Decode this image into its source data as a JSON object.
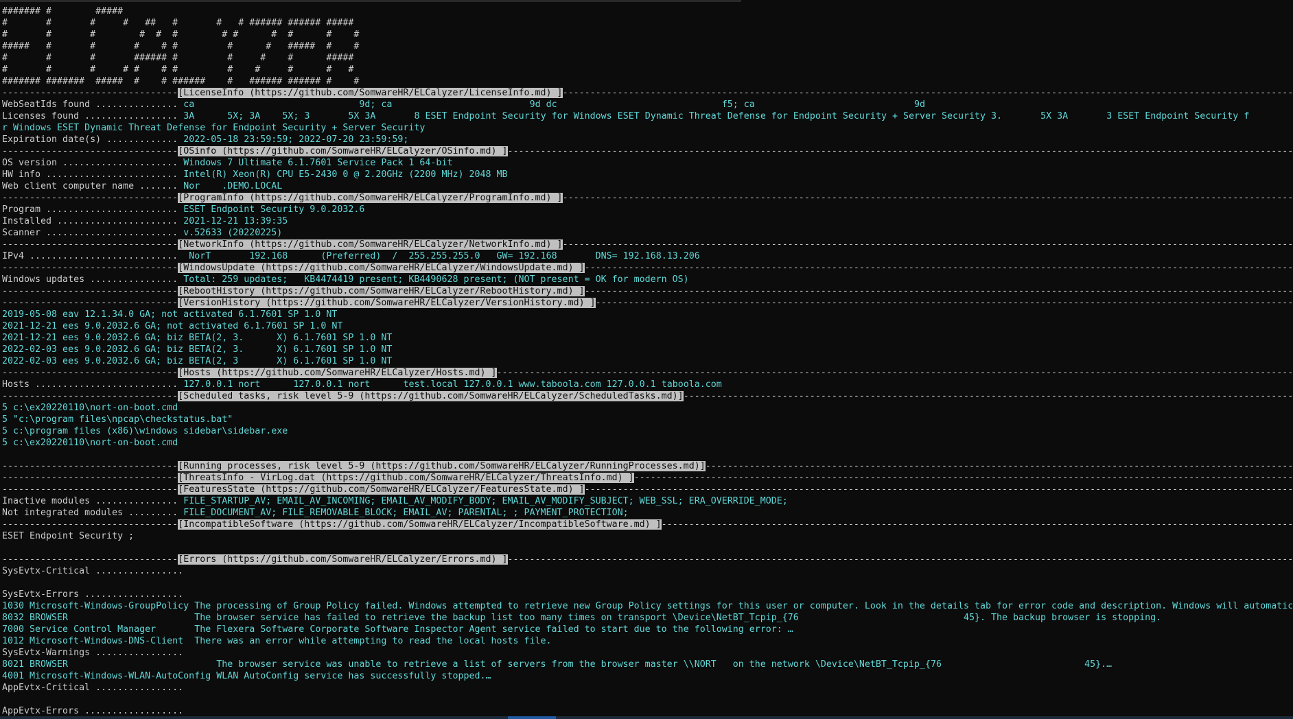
{
  "banner": [
    "####### #        #####",
    "#       #       #     #   ##   #       #   # ###### ###### #####",
    "#       #       #        #  #  #        # #      #  #      #    #",
    "#####   #       #       #    # #         #      #   #####  #    #",
    "#       #       #       ###### #         #     #    #      #####",
    "#       #       #     # #    # #         #    #     #      #   #",
    "####### #######  #####  #    # ######    #   ###### ###### #    #"
  ],
  "separator": "--------------------------------------------------------------------------------------------------------------------------------------------------------------------------------------------------------------------------------------------------------------------------------------------------------------",
  "sections": {
    "license": "[LicenseInfo (https://github.com/SomwareHR/ELCalyzer/LicenseInfo.md) ]",
    "os": "[OSinfo (https://github.com/SomwareHR/ELCalyzer/OSinfo.md) ]",
    "program": "[ProgramInfo (https://github.com/SomwareHR/ELCalyzer/ProgramInfo.md) ]",
    "network": "[NetworkInfo (https://github.com/SomwareHR/ELCalyzer/NetworkInfo.md) ]",
    "windows_update": "[WindowsUpdate (https://github.com/SomwareHR/ELCalyzer/WindowsUpdate.md) ]",
    "reboot": "[RebootHistory (https://github.com/SomwareHR/ELCalyzer/RebootHistory.md) ]",
    "version": "[VersionHistory (https://github.com/SomwareHR/ELCalyzer/VersionHistory.md) ]",
    "hosts": "[Hosts (https://github.com/SomwareHR/ELCalyzer/Hosts.md) ]",
    "scheduled": "[Scheduled tasks, risk level 5-9 (https://github.com/SomwareHR/ELCalyzer/ScheduledTasks.md)]",
    "running": "[Running processes, risk level 5-9 (https://github.com/SomwareHR/ELCalyzer/RunningProcesses.md)]",
    "threats": "[ThreatsInfo - VirLog.dat (https://github.com/SomwareHR/ELCalyzer/ThreatsInfo.md) ]",
    "features": "[FeaturesState (https://github.com/SomwareHR/ELCalyzer/FeaturesState.md) ]",
    "incompatible": "[IncompatibleSoftware (https://github.com/SomwareHR/ELCalyzer/IncompatibleSoftware.md) ]",
    "errors": "[Errors (https://github.com/SomwareHR/ELCalyzer/Errors.md) ]"
  },
  "license": {
    "seat_label": "WebSeatIds found ............... ",
    "seat_a": "ca",
    "seat_b": "9d; ca",
    "seat_c": "9d dc",
    "seat_d": "f5; ca",
    "seat_e": "9d",
    "lic_label": "Licenses found ................. ",
    "lic_a": "3A",
    "lic_b": "5X; 3A",
    "lic_c": "5X; 3",
    "lic_d": "5X 3A",
    "lic_e": "8 ESET Endpoint Security for Windows ESET Dynamic Threat Defense for Endpoint Security + Server Security 3.",
    "lic_f": "5X 3A",
    "lic_g": "3 ESET Endpoint Security f",
    "lic_cont": "r Windows ESET Dynamic Threat Defense for Endpoint Security + Server Security",
    "exp_label": "Expiration date(s) ............. ",
    "exp_value": "2022-05-18 23:59:59; 2022-07-20 23:59:59;"
  },
  "os": {
    "ver_label": "OS version ..................... ",
    "ver_value": "Windows 7 Ultimate 6.1.7601 Service Pack 1 64-bit",
    "hw_label": "HW info ........................ ",
    "hw_value": "Intel(R) Xeon(R) CPU E5-2430 0 @ 2.20GHz (2200 MHz) 2048 MB",
    "client_label": "Web client computer name ....... ",
    "client_a": "Nor",
    "client_b": ".DEMO.LOCAL"
  },
  "program": {
    "prog_label": "Program ........................ ",
    "prog_value": "ESET Endpoint Security 9.0.2032.6",
    "inst_label": "Installed ...................... ",
    "inst_value": "2021-12-21 13:39:35",
    "scan_label": "Scanner ........................ ",
    "scan_value": "v.52633 (20220225)"
  },
  "network": {
    "ipv4_label": "IPv4 ........................... ",
    "ipv4_a": " NorT",
    "ipv4_b": " 192.168",
    "ipv4_c": "(Preferred)  /  255.255.255.0   GW= 192.168",
    "ipv4_d": "DNS= 192.168.13.206"
  },
  "windows_update": {
    "label": "Windows updates ................ ",
    "value": "Total: 259 updates;   KB4474419 present; KB4490628 present; (NOT present = OK for modern OS)"
  },
  "versions": [
    {
      "a": "2019-05-08 eav 12.1.34.0 GA; not activated 6.1.7601 SP 1.0 NT",
      "b": "",
      "c": ""
    },
    {
      "a": "2021-12-21 ees 9.0.2032.6 GA; not activated 6.1.7601 SP 1.0 NT",
      "b": "",
      "c": ""
    },
    {
      "a": "2021-12-21 ees 9.0.2032.6 GA; biz BETA(2, 3.",
      "b": "",
      "c": "X) 6.1.7601 SP 1.0 NT"
    },
    {
      "a": "2022-02-03 ees 9.0.2032.6 GA; biz BETA(2, 3.",
      "b": "",
      "c": "X) 6.1.7601 SP 1.0 NT"
    },
    {
      "a": "2022-02-03 ees 9.0.2032.6 GA; biz BETA(2, 3",
      "b": "",
      "c": "X) 6.1.7601 SP 1.0 NT"
    }
  ],
  "hosts": {
    "label": "Hosts .......................... ",
    "a": "127.0.0.1 nort",
    "b": "127.0.0.1 nort",
    "c": "test.local 127.0.0.1 www.taboola.com 127.0.0.1 taboola.com"
  },
  "scheduled_tasks": [
    "5 c:\\ex20220110\\nort-on-boot.cmd",
    "5 \"c:\\program files\\npcap\\checkstatus.bat\"",
    "5 c:\\program files (x86)\\windows sidebar\\sidebar.exe",
    "5 c:\\ex20220110\\nort-on-boot.cmd"
  ],
  "features": {
    "inactive_label": "Inactive modules ............... ",
    "inactive_value": "FILE_STARTUP_AV; EMAIL_AV_INCOMING; EMAIL_AV_MODIFY_BODY; EMAIL_AV_MODIFY_SUBJECT; WEB_SSL; ERA_OVERRIDE_MODE;",
    "notint_label": "Not integrated modules ......... ",
    "notint_value": "FILE_DOCUMENT_AV; FILE_REMOVABLE_BLOCK; EMAIL_AV; PARENTAL; ; PAYMENT_PROTECTION;"
  },
  "incompatible_value": "ESET Endpoint Security ;",
  "errors": {
    "sys_critical": "SysEvtx-Critical ................",
    "sys_errors": "SysEvtx-Errors ..................",
    "e1_src": "1030 Microsoft-Windows-GroupPolicy ",
    "e1_msg": "The processing of Group Policy failed. Windows attempted to retrieve new Group Policy settings for this user or computer. Look in the details tab for error code and description. Windows will automatic",
    "e2_src": "8032 BROWSER                       ",
    "e2_msg_a": "The browser service has failed to retrieve the backup list too many times on transport \\Device\\NetBT_Tcpip_{76",
    "e2_msg_b": "45}. The backup browser is stopping.",
    "e3_src": "7000 Service Control Manager       ",
    "e3_msg": "The Flexera Software Corporate Software Inspector Agent service failed to start due to the following error: …",
    "e4_src": "1012 Microsoft-Windows-DNS-Client  ",
    "e4_msg": "There was an error while attempting to read the local hosts file.",
    "sys_warnings": "SysEvtx-Warnings ................",
    "w1_src": "8021 BROWSER                           ",
    "w1_msg_a": "The browser service was unable to retrieve a list of servers from the browser master \\\\NORT",
    "w1_msg_b": "on the network \\Device\\NetBT_Tcpip_{76",
    "w1_msg_c": "45}.…",
    "w2": "4001 Microsoft-Windows-WLAN-AutoConfig WLAN AutoConfig service has successfully stopped.…",
    "app_critical": "AppEvtx-Critical ................",
    "app_errors": "AppEvtx-Errors .................."
  }
}
